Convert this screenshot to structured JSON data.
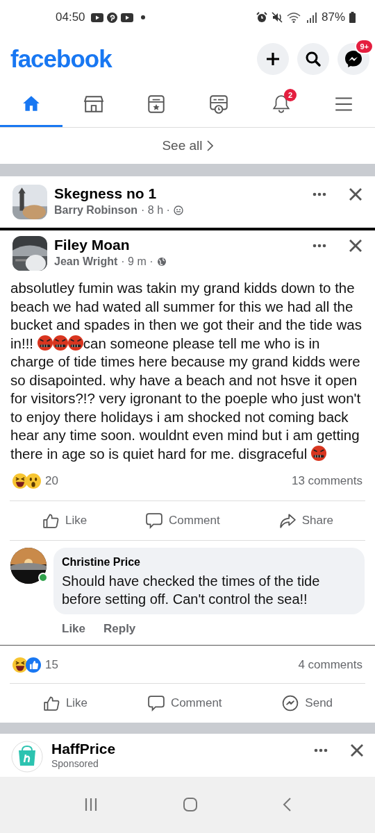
{
  "status_bar": {
    "time": "04:50",
    "battery": "87%"
  },
  "header": {
    "logo": "facebook",
    "messenger_badge": "9+"
  },
  "tabs": [
    {
      "kind": "home",
      "selected": true
    },
    {
      "kind": "marketplace",
      "selected": false
    },
    {
      "kind": "pages",
      "selected": false
    },
    {
      "kind": "memories",
      "selected": false
    },
    {
      "kind": "notifications",
      "selected": false,
      "badge": "2"
    },
    {
      "kind": "menu",
      "selected": false
    }
  ],
  "see_all": "See all",
  "posts": [
    {
      "group": "Skegness no 1",
      "author": "Barry Robinson",
      "time": "· 8 h ·",
      "audience": {
        "kind": "friends"
      }
    },
    {
      "group": "Filey Moan",
      "author": "Jean Wright",
      "time": "· 9 m ·",
      "audience": {
        "kind": "public"
      },
      "body": [
        {
          "kind": "text",
          "text": "absolutley fumin was takin my grand kidds down to the beach we had wated all summer for this we had all the bucket and spades in then we got their and the tide was in!!! "
        },
        {
          "kind": "emoji"
        },
        {
          "kind": "emoji"
        },
        {
          "kind": "emoji"
        },
        {
          "kind": "text",
          "text": "can someone please tell me who is in charge of tide times here because my grand kidds were so disapointed. why have a beach and not hsve it open for visitors?!? very igronant to the poeple who just won't to enjoy there holidays i am shocked not coming back hear any time soon. wouldnt even mind but i am getting there in age so is quiet hard for me. disgraceful "
        },
        {
          "kind": "emoji"
        }
      ],
      "reactions": {
        "count": "20",
        "types": [
          {
            "kind": "haha"
          },
          {
            "kind": "wow"
          }
        ]
      },
      "comments": "13 comments",
      "actions": [
        {
          "kind": "like",
          "label": "Like"
        },
        {
          "kind": "comment",
          "label": "Comment"
        },
        {
          "kind": "share",
          "label": "Share"
        }
      ],
      "top_comment": {
        "author": "Christine Price",
        "text": "Should have checked the times of the tide before setting off. Can't control the sea!!",
        "online": true,
        "actions": [
          "Like",
          "Reply"
        ]
      }
    }
  ],
  "shared_footer": {
    "reactions": {
      "count": "15",
      "types": [
        {
          "kind": "haha"
        },
        {
          "kind": "like"
        }
      ]
    },
    "comments": "4 comments",
    "actions": [
      {
        "kind": "like",
        "label": "Like"
      },
      {
        "kind": "comment",
        "label": "Comment"
      },
      {
        "kind": "send",
        "label": "Send"
      }
    ]
  },
  "next_post": {
    "page": "HaffPrice",
    "meta": "Sponsored"
  }
}
